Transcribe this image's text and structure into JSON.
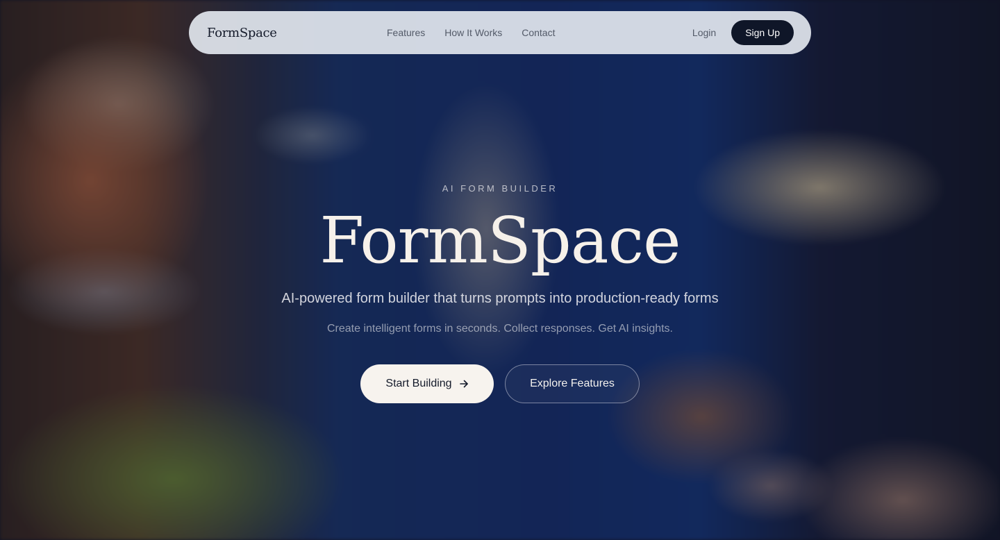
{
  "nav": {
    "logo": "FormSpace",
    "links": [
      "Features",
      "How It Works",
      "Contact"
    ],
    "login_label": "Login",
    "signup_label": "Sign Up"
  },
  "hero": {
    "eyebrow": "AI FORM BUILDER",
    "title": "FormSpace",
    "subtitle": "AI-powered form builder that turns prompts into production-ready forms",
    "tagline": "Create intelligent forms in seconds. Collect responses. Get AI insights.",
    "primary_cta": "Start Building",
    "primary_cta_icon": "arrow-right-icon",
    "secondary_cta": "Explore Features"
  },
  "colors": {
    "nav_bg": "#e2e6ee",
    "brand_dark": "#0f1628",
    "cta_light": "#f7f3ee",
    "title_color": "#f6f1ea"
  }
}
